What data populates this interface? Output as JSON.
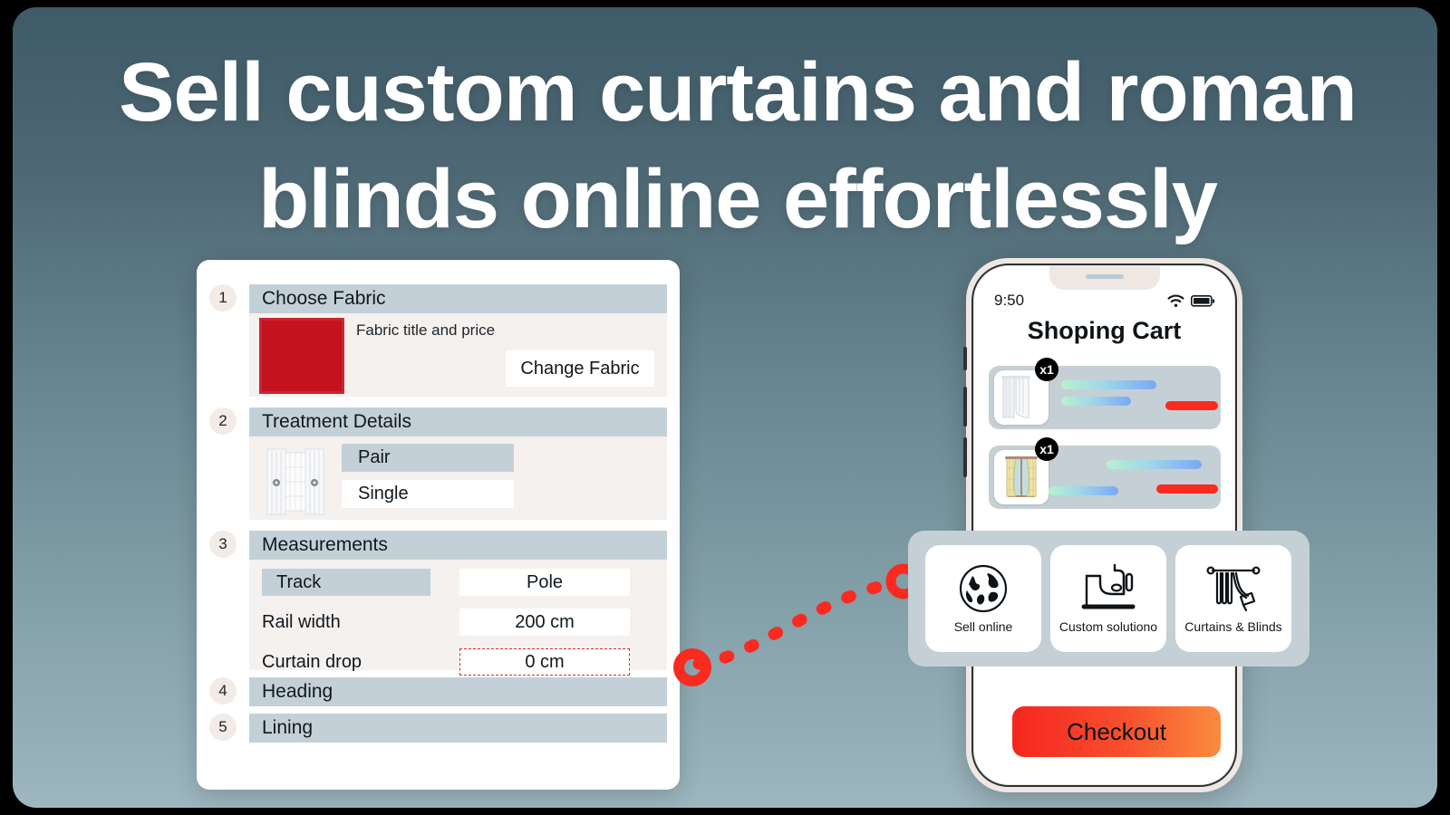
{
  "headline": {
    "line1": "Sell custom curtains and roman",
    "line2": "blinds online effortlessly"
  },
  "colors": {
    "bg_top": "#3f5b67",
    "bg_bottom": "#9db6bf",
    "header_bar": "#c4d0d7",
    "panel_body": "#f5f1ef",
    "step_circle": "#f2ebe6",
    "swatch_red": "#c4121f",
    "accent_red": "#fa2a20",
    "checkout_from": "#f5261f",
    "checkout_to": "#fb8c3e"
  },
  "configurator": {
    "steps": [
      {
        "number": "1",
        "title": "Choose Fabric",
        "fabric_label": "Fabric title and price",
        "change_button": "Change Fabric",
        "swatch_name": "fabric-swatch-red"
      },
      {
        "number": "2",
        "title": "Treatment Details",
        "icon_name": "curtain-pair-icon",
        "options": [
          {
            "label": "Pair",
            "selected": true
          },
          {
            "label": "Single",
            "selected": false
          }
        ]
      },
      {
        "number": "3",
        "title": "Measurements",
        "rows": [
          {
            "label": "Track",
            "label_is_chip": true,
            "value": "Pole",
            "alert": false
          },
          {
            "label": "Rail width",
            "label_is_chip": false,
            "value": "200 cm",
            "alert": false
          },
          {
            "label": "Curtain drop",
            "label_is_chip": false,
            "value": "0 cm",
            "alert": true
          }
        ]
      },
      {
        "number": "4",
        "title": "Heading"
      },
      {
        "number": "5",
        "title": "Lining"
      }
    ]
  },
  "phone": {
    "status": {
      "time": "9:50",
      "wifi_icon": "wifi-icon",
      "battery_icon": "battery-icon"
    },
    "cart_title": "Shoping Cart",
    "items": [
      {
        "qty": "x1",
        "thumb_name": "white-curtain-thumbnail"
      },
      {
        "qty": "x1",
        "thumb_name": "plaid-curtain-window-thumbnail"
      }
    ],
    "checkout_label": "Checkout"
  },
  "features": {
    "cards": [
      {
        "label": "Sell online",
        "icon_name": "globe-icon"
      },
      {
        "label": "Custom solutiono",
        "icon_name": "sewing-machine-icon"
      },
      {
        "label": "Curtains & Blinds",
        "icon_name": "curtain-rod-icon"
      }
    ]
  },
  "connector": {
    "name": "dashed-arrow-connector",
    "color": "#fa2a20"
  }
}
